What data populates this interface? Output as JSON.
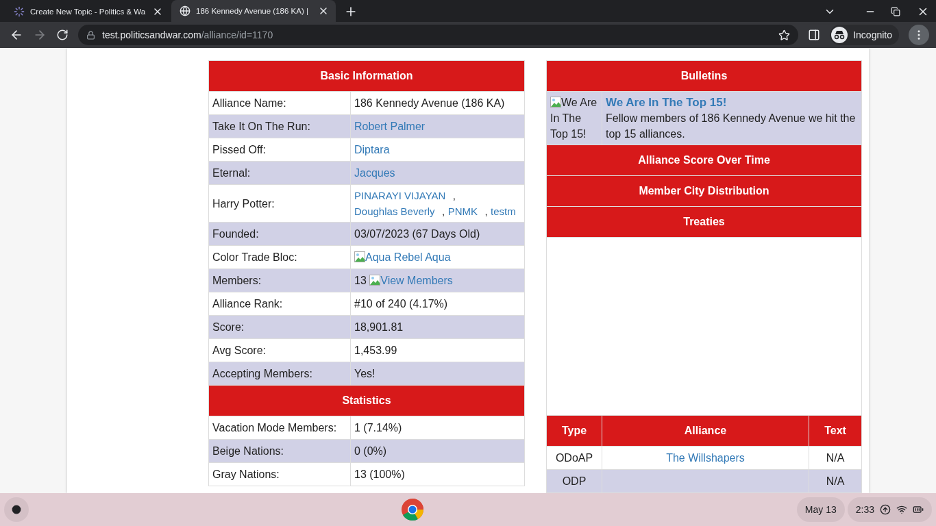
{
  "browser": {
    "tabs": [
      {
        "title": "Create New Topic - Politics & Wa",
        "selected": false
      },
      {
        "title": "186 Kennedy Avenue (186 KA) |",
        "selected": true
      }
    ],
    "url": {
      "domain": "test.politicsandwar.com",
      "path": "/alliance/id=1170"
    },
    "profile": "Incognito"
  },
  "basic_information": {
    "title": "Basic Information",
    "rows": [
      {
        "label": "Alliance Name:",
        "parts": [
          {
            "kind": "text",
            "text": "186 Kennedy Avenue (186 KA)"
          }
        ]
      },
      {
        "label": "Take It On The Run:",
        "parts": [
          {
            "kind": "link",
            "text": "Robert Palmer"
          }
        ]
      },
      {
        "label": "Pissed Off:",
        "parts": [
          {
            "kind": "link",
            "text": "Diptara"
          }
        ]
      },
      {
        "label": "Eternal:",
        "parts": [
          {
            "kind": "link",
            "text": "Jacques"
          }
        ]
      },
      {
        "label": "Harry Potter:",
        "parts": [
          {
            "kind": "link",
            "text": "PINARAYI VIJAYAN"
          },
          {
            "kind": "text",
            "text": ","
          },
          {
            "kind": "link",
            "text": "Doughlas Beverly"
          },
          {
            "kind": "text",
            "text": ","
          },
          {
            "kind": "link",
            "text": "PNMK"
          },
          {
            "kind": "text",
            "text": ","
          },
          {
            "kind": "link",
            "text": "testm"
          }
        ]
      },
      {
        "label": "Founded:",
        "parts": [
          {
            "kind": "text",
            "text": "03/07/2023 (67 Days Old)"
          }
        ]
      },
      {
        "label": "Color Trade Bloc:",
        "parts": [
          {
            "kind": "image-link",
            "text": "Aqua"
          },
          {
            "kind": "link",
            "text": "Rebel Aqua"
          }
        ]
      },
      {
        "label": "Members:",
        "parts": [
          {
            "kind": "text",
            "text": "13"
          },
          {
            "kind": "image-link",
            "text": "View Members"
          }
        ]
      },
      {
        "label": "Alliance Rank:",
        "parts": [
          {
            "kind": "text",
            "text": "#10 of 240 (4.17%)"
          }
        ]
      },
      {
        "label": "Score:",
        "parts": [
          {
            "kind": "text",
            "text": "18,901.81"
          }
        ]
      },
      {
        "label": "Avg Score:",
        "parts": [
          {
            "kind": "text",
            "text": "1,453.99"
          }
        ]
      },
      {
        "label": "Accepting Members:",
        "parts": [
          {
            "kind": "text",
            "text": "Yes!"
          }
        ]
      }
    ]
  },
  "statistics": {
    "title": "Statistics",
    "rows": [
      {
        "label": "Vacation Mode Members:",
        "parts": [
          {
            "kind": "text",
            "text": "1 (7.14%)"
          }
        ]
      },
      {
        "label": "Beige Nations:",
        "parts": [
          {
            "kind": "text",
            "text": "0 (0%)"
          }
        ]
      },
      {
        "label": "Gray Nations:",
        "parts": [
          {
            "kind": "text",
            "text": "13 (100%)"
          }
        ]
      }
    ]
  },
  "bulletins": {
    "title": "Bulletins",
    "items": [
      {
        "image_alt": "We Are In The Top 15!",
        "title": "We Are In The Top 15!",
        "text": "Fellow members of 186 Kennedy Avenue we hit the top 15 alliances."
      }
    ]
  },
  "sections": [
    "Alliance Score Over Time",
    "Member City Distribution",
    "Treaties"
  ],
  "treaties": {
    "columns": [
      "Type",
      "Alliance",
      "Text"
    ],
    "rows": [
      {
        "type": "ODoAP",
        "alliance": "The Willshapers",
        "text": "N/A"
      },
      {
        "type": "ODP",
        "text": "N/A"
      }
    ]
  },
  "taskbar": {
    "date": "May 13",
    "time": "2:33"
  }
}
